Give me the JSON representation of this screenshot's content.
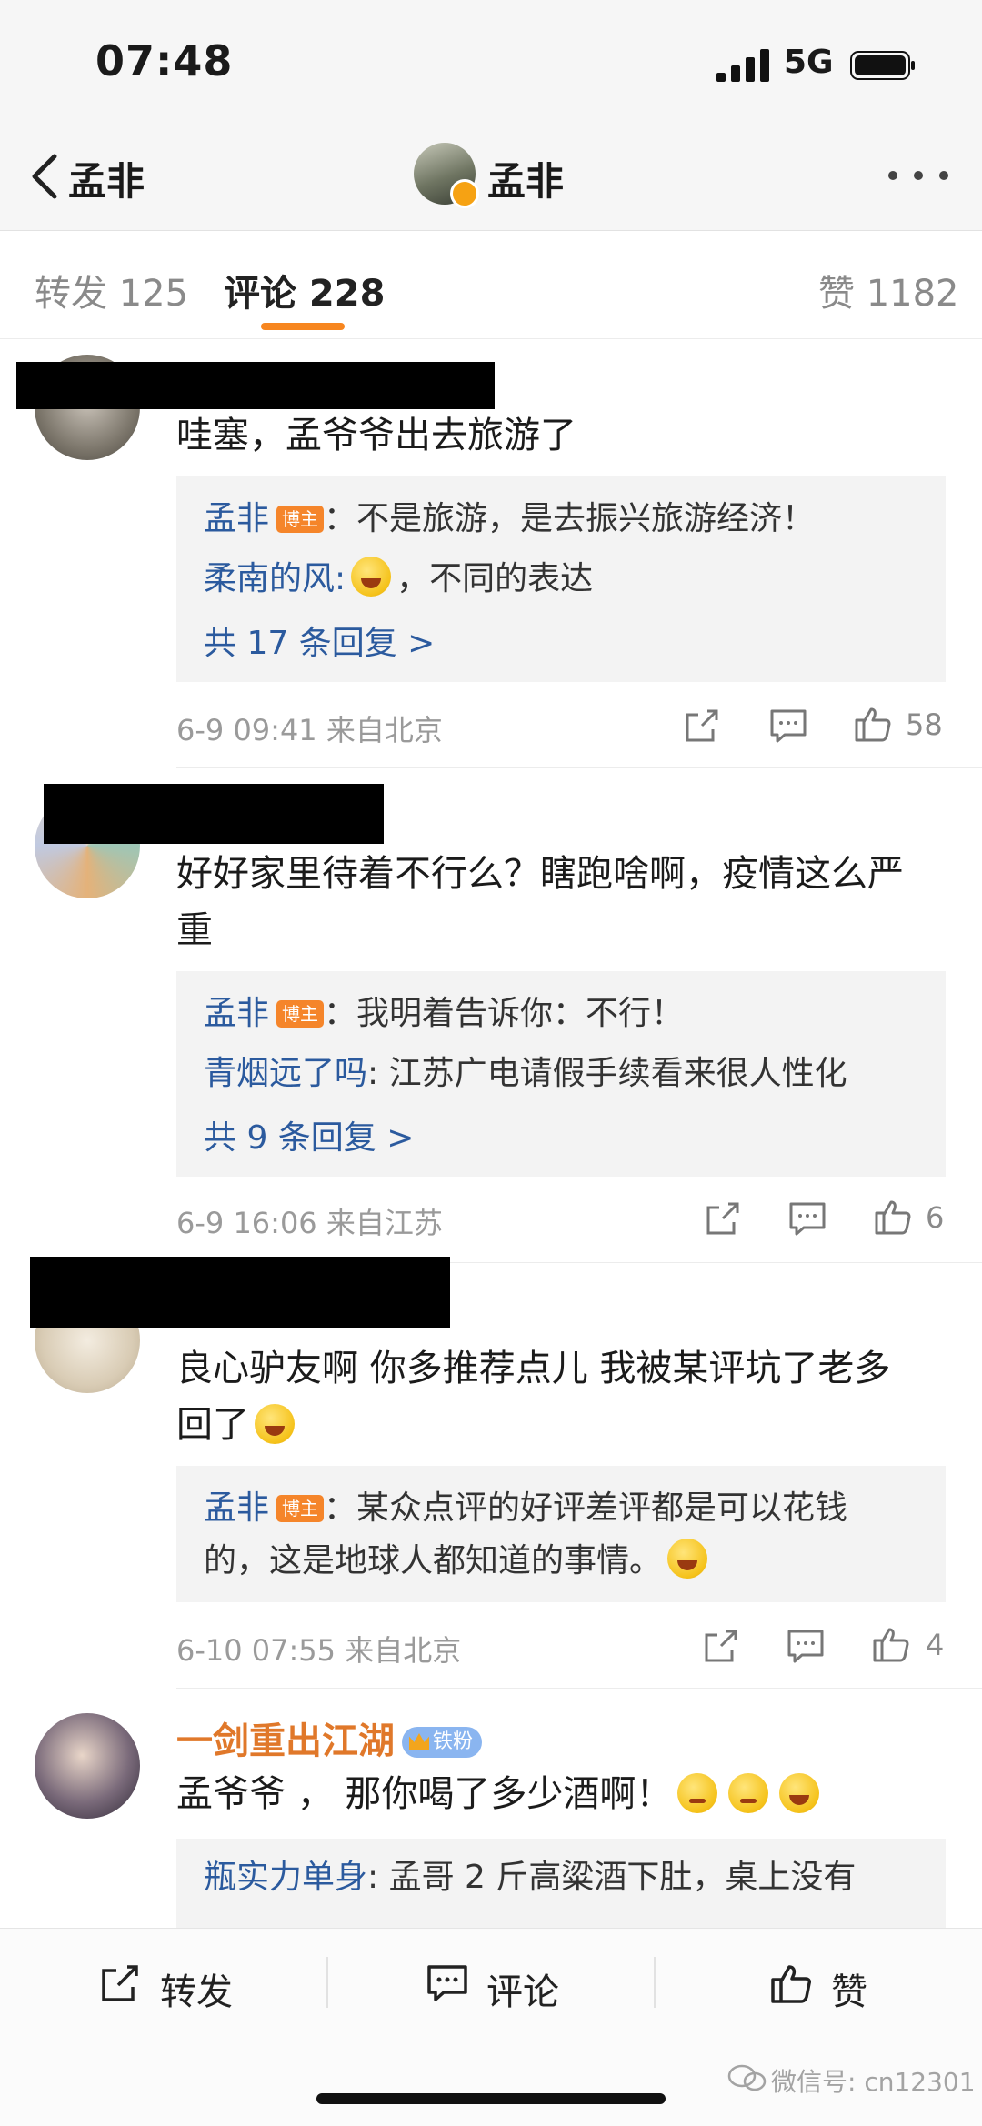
{
  "status_bar": {
    "time": "07:48",
    "network": "5G"
  },
  "nav": {
    "back_label": "孟非",
    "title": "孟非"
  },
  "tabs": [
    {
      "label": "转发 125"
    },
    {
      "label": "评论 228"
    },
    {
      "label": "赞 1182"
    }
  ],
  "comments": [
    {
      "text": "哇塞，孟爷爷出去旅游了",
      "replies": [
        {
          "user": "孟非",
          "tag": "博主",
          "text": "：不是旅游，是去振兴旅游经济！"
        },
        {
          "user": "柔南的风",
          "text": "，不同的表达"
        }
      ],
      "more_replies": "共 17 条回复 >",
      "time": "6-9 09:41",
      "location": "来自北京",
      "likes": "58"
    },
    {
      "text_line1": "好好家里待着不行么？瞎跑啥啊，疫情这么严",
      "text_line2": "重",
      "replies": [
        {
          "user": "孟非",
          "tag": "博主",
          "text": "：我明着告诉你：不行！"
        },
        {
          "user": "青烟远了吗",
          "text": ": 江苏广电请假手续看来很人性化"
        }
      ],
      "more_replies": "共 9 条回复 >",
      "time": "6-9 16:06",
      "location": "来自江苏",
      "likes": "6"
    },
    {
      "text_line1": "良心驴友啊 你多推荐点儿 我被某评坑了老多",
      "text_line2": "回了",
      "replies": [
        {
          "user": "孟非",
          "tag": "博主",
          "text": "：某众点评的好评差评都是可以花钱",
          "text_line2": "的，这是地球人都知道的事情。"
        }
      ],
      "time": "6-10 07:55",
      "location": "来自北京",
      "likes": "4"
    },
    {
      "user": "一剑重出江湖",
      "badge": "铁粉",
      "text": "孟爷爷 ， 那你喝了多少酒啊！",
      "replies": [
        {
          "user": "瓶实力单身",
          "text": ": 孟哥 2 斤高粱酒下肚，桌上没有"
        }
      ]
    }
  ],
  "bottom_bar": {
    "repost": "转发",
    "comment": "评论",
    "like": "赞"
  },
  "watermark": "微信号: cn12301",
  "colors": {
    "accent": "#f7861f",
    "link": "#2b5a9e",
    "fan": "#e0782a"
  }
}
